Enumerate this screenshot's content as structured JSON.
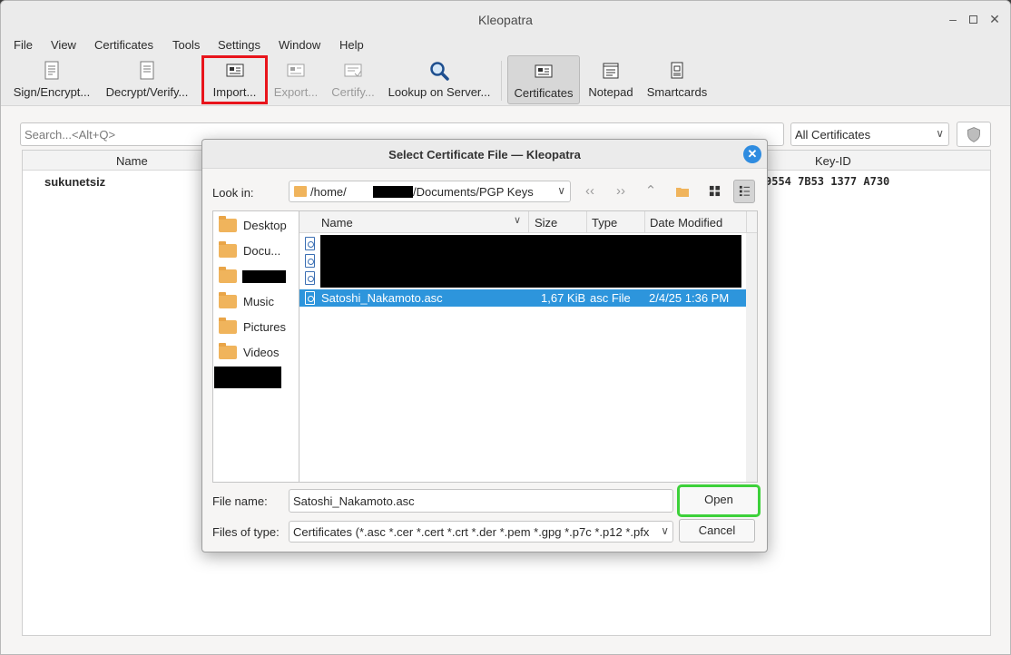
{
  "window": {
    "title": "Kleopatra"
  },
  "menubar": {
    "items": [
      {
        "label": "File"
      },
      {
        "label": "View"
      },
      {
        "label": "Certificates"
      },
      {
        "label": "Tools"
      },
      {
        "label": "Settings"
      },
      {
        "label": "Window"
      },
      {
        "label": "Help"
      }
    ]
  },
  "toolbar": {
    "sign_encrypt": "Sign/Encrypt...",
    "decrypt_verify": "Decrypt/Verify...",
    "import": "Import...",
    "export": "Export...",
    "certify": "Certify...",
    "lookup": "Lookup on Server...",
    "certificates": "Certificates",
    "notepad": "Notepad",
    "smartcards": "Smartcards"
  },
  "main": {
    "search_placeholder": "Search...<Alt+Q>",
    "filter_value": "All Certificates",
    "columns": {
      "name": "Name",
      "key_id": "Key-ID"
    },
    "rows": [
      {
        "name": "sukunetsiz",
        "key_id": "9554 7B53 1377 A730"
      }
    ]
  },
  "dialog": {
    "title": "Select Certificate File — Kleopatra",
    "look_in_label": "Look in:",
    "look_in_prefix": "/home/",
    "look_in_suffix": "/Documents/PGP Keys",
    "sidebar": [
      {
        "label": "Desktop"
      },
      {
        "label": "Docu..."
      },
      {
        "label": ""
      },
      {
        "label": "Music"
      },
      {
        "label": "Pictures"
      },
      {
        "label": "Videos"
      }
    ],
    "columns": {
      "name": "Name",
      "size": "Size",
      "type": "Type",
      "date": "Date Modified"
    },
    "selected_file": {
      "name": "Satoshi_Nakamoto.asc",
      "size": "1,67 KiB",
      "type": "asc File",
      "date": "2/4/25 1:36 PM"
    },
    "file_name_label": "File name:",
    "file_name_value": "Satoshi_Nakamoto.asc",
    "files_of_type_label": "Files of type:",
    "files_of_type_value": "Certificates (*.asc *.cer *.cert *.crt *.der *.pem *.gpg *.p7c *.p12 *.pfx",
    "open_button": "Open",
    "cancel_button": "Cancel"
  },
  "colors": {
    "selection": "#2d95dc",
    "import_highlight": "#e8141b",
    "open_highlight": "#3dd13a",
    "folder": "#f0b45c"
  }
}
